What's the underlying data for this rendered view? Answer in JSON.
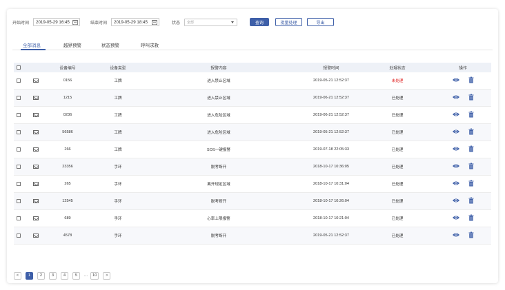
{
  "filters": {
    "start_label": "开始时间",
    "start_value": "2019-05-29 16:45",
    "end_label": "结束时间",
    "end_value": "2019-05-29 18:45",
    "status_label": "状态",
    "status_value": "全部"
  },
  "buttons": {
    "query": "查询",
    "batch": "批量处理",
    "export": "导出"
  },
  "tabs": [
    {
      "label": "全部消息",
      "active": true
    },
    {
      "label": "越界预警",
      "active": false
    },
    {
      "label": "状态预警",
      "active": false
    },
    {
      "label": "呼叫求救",
      "active": false
    }
  ],
  "table": {
    "columns": [
      "设备编号",
      "设备类型",
      "报警内容",
      "报警时间",
      "处理状态",
      "操作"
    ],
    "rows": [
      {
        "id": "0156",
        "type": "工牌",
        "content": "进入禁止区域",
        "time": "2019-05-21 12:52:37",
        "status": "未处理"
      },
      {
        "id": "1215",
        "type": "工牌",
        "content": "进入禁止区域",
        "time": "2019-06-21 12:52:37",
        "status": "已处理"
      },
      {
        "id": "0236",
        "type": "工牌",
        "content": "进入危险区域",
        "time": "2019-06-21 12:52:37",
        "status": "已处理"
      },
      {
        "id": "56586",
        "type": "工牌",
        "content": "进入危险区域",
        "time": "2019-05-21 12:52:37",
        "status": "已处理"
      },
      {
        "id": "266",
        "type": "工牌",
        "content": "SOS一键报警",
        "time": "2019-07-18 22:05:33",
        "status": "已处理"
      },
      {
        "id": "23356",
        "type": "手环",
        "content": "脱考断开",
        "time": "2018-10-17 10:36:05",
        "status": "已处理"
      },
      {
        "id": "265",
        "type": "手环",
        "content": "离开规定区域",
        "time": "2018-10-17 10:31:04",
        "status": "已处理"
      },
      {
        "id": "12545",
        "type": "手环",
        "content": "脱考断开",
        "time": "2018-10-17 10:26:04",
        "status": "已处理"
      },
      {
        "id": "689",
        "type": "手环",
        "content": "心率上限报警",
        "time": "2018-10-17 10:21:04",
        "status": "已处理"
      },
      {
        "id": "4578",
        "type": "手环",
        "content": "脱考断开",
        "time": "2019-05-21 12:52:37",
        "status": "已处理"
      }
    ]
  },
  "pagination": {
    "prev": "<",
    "pages": [
      "1",
      "2",
      "3",
      "4",
      "5"
    ],
    "ellipsis": "...",
    "last": "10",
    "next": ">",
    "current": "1"
  },
  "colors": {
    "primary": "#3e5fa8",
    "unhandled": "#e02020",
    "header_bg": "#eef1f7"
  },
  "icons": {
    "view": "eye-icon",
    "delete": "trash-icon",
    "message": "envelope-icon",
    "calendar": "calendar-icon"
  }
}
